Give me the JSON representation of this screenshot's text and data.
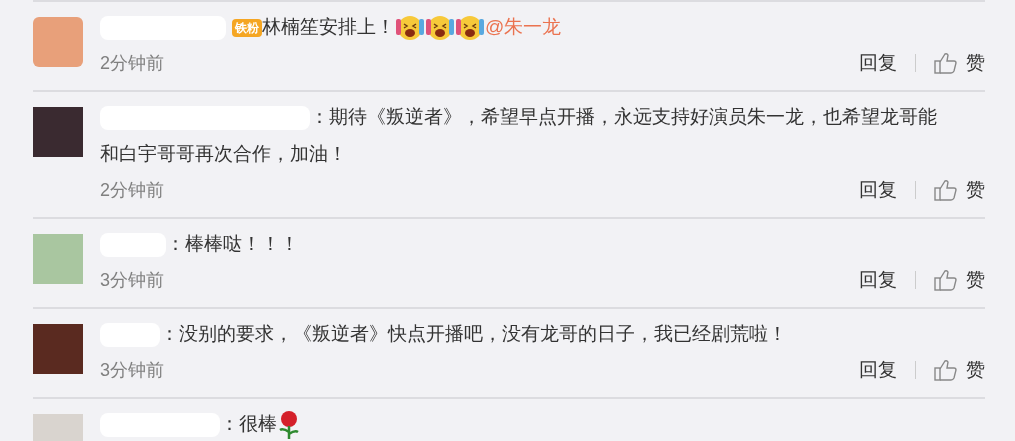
{
  "comments": [
    {
      "avatar": {
        "kind": "cartoon"
      },
      "lines": [
        "林楠笙安排上！"
      ],
      "badge": {
        "text": "铁粉"
      },
      "emojis": [
        {
          "kind": "laugh"
        },
        {
          "kind": "laugh"
        },
        {
          "kind": "laugh"
        }
      ],
      "mention": "@朱一龙",
      "time": "2分钟前",
      "reply": "回复",
      "like": "赞"
    },
    {
      "avatar": {
        "kind": "photo"
      },
      "lines": [
        "：期待《叛逆者》，希望早点开播，永远支持好演员朱一龙，也希望龙哥能",
        "和白宇哥哥再次合作，加油！"
      ],
      "time": "2分钟前",
      "reply": "回复",
      "like": "赞"
    },
    {
      "avatar": {
        "kind": "photo"
      },
      "lines": [
        "：棒棒哒！！！"
      ],
      "time": "3分钟前",
      "reply": "回复",
      "like": "赞"
    },
    {
      "avatar": {
        "kind": "photo"
      },
      "lines": [
        "：没别的要求，《叛逆者》快点开播吧，没有龙哥的日子，我已经剧荒啦！"
      ],
      "time": "3分钟前",
      "reply": "回复",
      "like": "赞"
    },
    {
      "avatar": {
        "kind": "photo"
      },
      "lines": [
        "：很棒"
      ],
      "emojis": [
        {
          "kind": "rose"
        }
      ]
    }
  ]
}
